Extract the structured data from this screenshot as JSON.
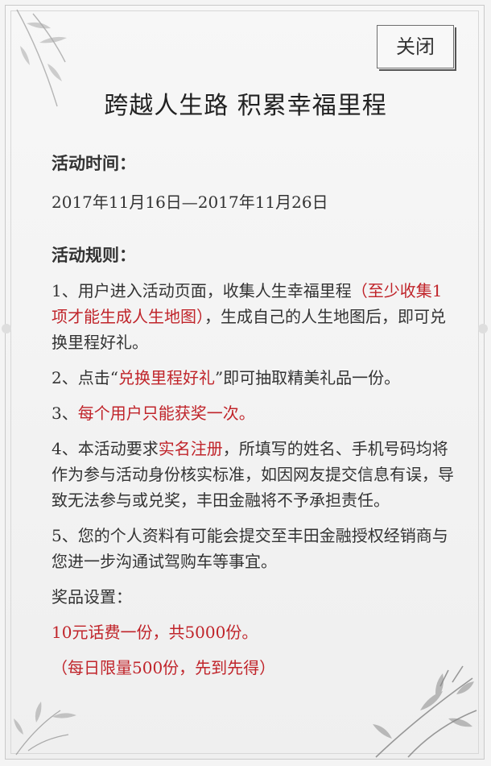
{
  "close_button": {
    "label": "关闭"
  },
  "title": "跨越人生路 积累幸福里程",
  "activity_time": {
    "heading": "活动时间：",
    "value": "2017年11月16日—2017年11月26日"
  },
  "rules": {
    "heading": "活动规则：",
    "rule1": {
      "text_a": "1、用户进入活动页面，收集人生幸福里程",
      "highlight": "（至少收集1项才能生成人生地图）",
      "text_b": "，生成自己的人生地图后，即可兑换里程好礼。"
    },
    "rule2": {
      "text_a": "2、点击“",
      "highlight": "兑换里程好礼",
      "text_b": "”即可抽取精美礼品一份。"
    },
    "rule3": {
      "prefix": "3、",
      "highlight": "每个用户只能获奖一次。"
    },
    "rule4": {
      "text_a": "4、本活动要求",
      "highlight": "实名注册",
      "text_b": "，所填写的姓名、手机号码均将作为参与活动身份核实标准，如因网友提交信息有误，导致无法参与或兑奖，丰田金融将不予承担责任。"
    },
    "rule5": {
      "text": "5、您的个人资料有可能会提交至丰田金融授权经销商与您进一步沟通试驾购车等事宜。"
    }
  },
  "prizes": {
    "heading": "奖品设置：",
    "line1": "10元话费一份，共5000份。",
    "line2": "（每日限量500份，先到先得）"
  },
  "colors": {
    "highlight": "#c0242a",
    "text": "#333333",
    "background": "#f4f4f4"
  },
  "decorations": [
    "bamboo-ink-top-left",
    "bamboo-ink-bottom-left",
    "bamboo-ink-bottom-right"
  ]
}
